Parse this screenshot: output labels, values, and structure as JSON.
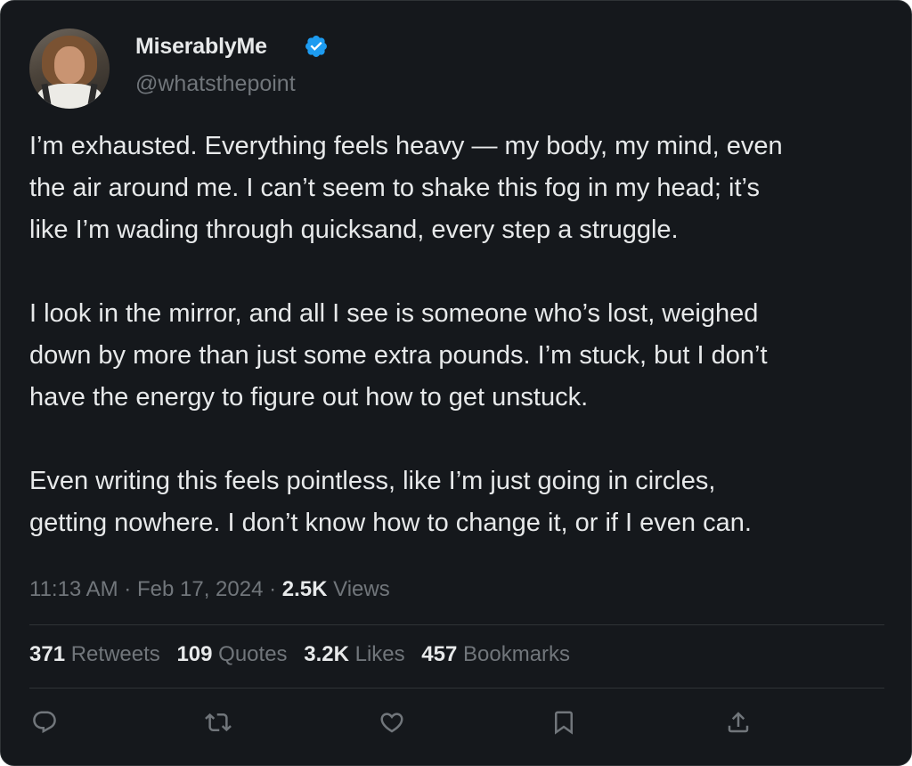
{
  "author": {
    "display_name": "MiserablyMe",
    "handle": "@whatsthepoint",
    "verified": true
  },
  "tweet": {
    "paragraphs": [
      [
        "I’m exhausted. Everything feels heavy — my body, my mind, even",
        "the air around me. I can’t seem to shake this fog in my head; it’s",
        "like I’m wading through quicksand, every step a struggle."
      ],
      [
        "I look in the mirror, and all I see is someone who’s lost, weighed",
        "down by more than just some extra pounds. I’m stuck, but I don’t",
        "have the energy to figure out how to get unstuck."
      ],
      [
        "Even writing this feels pointless, like I’m just going in circles,",
        "getting nowhere. I don’t know how to change it, or if I even can."
      ]
    ]
  },
  "meta": {
    "time": "11:13 AM",
    "date": "Feb 17, 2024",
    "separator": "·",
    "views_count": "2.5K",
    "views_label": "Views"
  },
  "stats": {
    "retweets": {
      "count": "371",
      "label": "Retweets"
    },
    "quotes": {
      "count": "109",
      "label": "Quotes"
    },
    "likes": {
      "count": "3.2K",
      "label": "Likes"
    },
    "bookmarks": {
      "count": "457",
      "label": "Bookmarks"
    }
  },
  "actions": [
    "reply-icon",
    "retweet-icon",
    "like-icon",
    "bookmark-icon",
    "share-icon"
  ],
  "colors": {
    "background": "#15181c",
    "text_primary": "#e7e9ea",
    "text_secondary": "#71767b",
    "verified_blue": "#1d9bf0",
    "divider": "#2f3336"
  }
}
